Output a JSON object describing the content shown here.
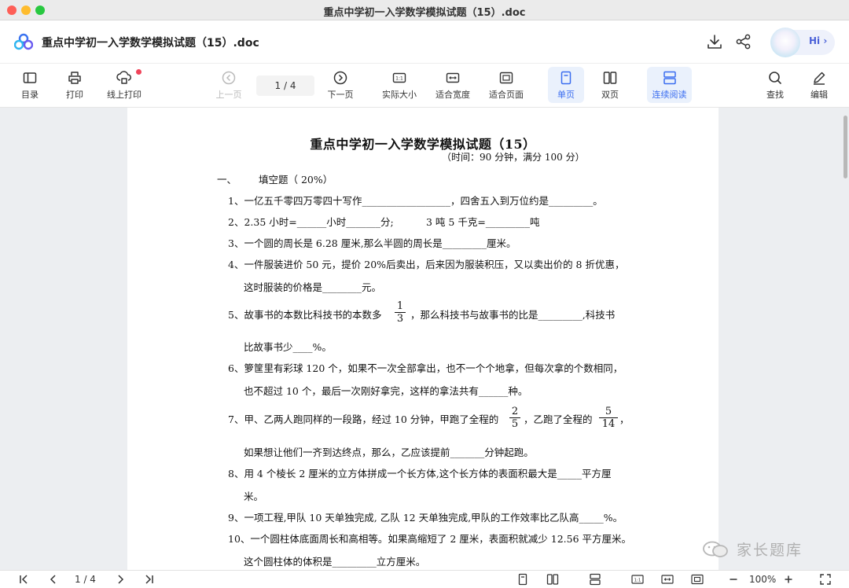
{
  "window": {
    "title": "重点中学初一入学数学模拟试题（15）.doc"
  },
  "header": {
    "doc_title": "重点中学初一入学数学模拟试题（15）.doc",
    "hi_label": "Hi ›"
  },
  "toolbar": {
    "toc": "目录",
    "print": "打印",
    "online_print": "线上打印",
    "prev_page": "上一页",
    "page_indicator": "1  / 4",
    "next_page": "下一页",
    "actual_size": "实际大小",
    "fit_width": "适合宽度",
    "fit_page": "适合页面",
    "single_page": "单页",
    "double_page": "双页",
    "continuous": "连续阅读",
    "find": "查找",
    "edit": "编辑"
  },
  "document": {
    "title": "重点中学初一入学数学模拟试题（15）",
    "subtitle": "（时间：90 分钟，满分 100 分）",
    "section_num": "一、",
    "section_title": "填空题（ 20%）",
    "lines": [
      "1、一亿五千零四万零四十写作__________________，四舍五入到万位约是_________。",
      "2、2.35 小时=______小时_______分;",
      "3 吨 5 千克=_________吨",
      "3、一个圆的周长是 6.28 厘米,那么半圆的周长是_________厘米。",
      "4、一件服装进价 50 元，提价 20%后卖出，后来因为服装积压，又以卖出价的 8 折优惠，",
      "这时服装的价格是________元。",
      "5、故事书的本数比科技书的本数多",
      "，那么科技书与故事书的比是_________,科技书",
      "比故事书少____%。",
      "6、箩筐里有彩球 120 个，如果不一次全部拿出，也不一个个地拿，但每次拿的个数相同，",
      "也不超过 10 个，最后一次刚好拿完，这样的拿法共有______种。",
      "7、甲、乙两人跑同样的一段路，经过 10 分钟，甲跑了全程的",
      "，乙跑了全程的",
      "，",
      "如果想让他们一齐到达终点，那么，乙应该提前_______分钟起跑。",
      "8、用 4 个棱长 2 厘米的立方体拼成一个长方体,这个长方体的表面积最大是_____平方厘",
      "米。",
      "9、一项工程,甲队 10 天单独完成, 乙队 12 天单独完成,甲队的工作效率比乙队高_____%。",
      "10、一个圆柱体底面周长和高相等。如果高缩短了 2 厘米，表面积就减少 12.56 平方厘米。",
      "这个圆柱体的体积是_________立方厘米。"
    ],
    "fractions": [
      {
        "num": "1",
        "den": "3"
      },
      {
        "num": "2",
        "den": "5"
      },
      {
        "num": "5",
        "den": "14"
      }
    ]
  },
  "watermark": {
    "text": "家长题库"
  },
  "statusbar": {
    "page_indicator": "1  / 4",
    "zoom": "100%"
  }
}
